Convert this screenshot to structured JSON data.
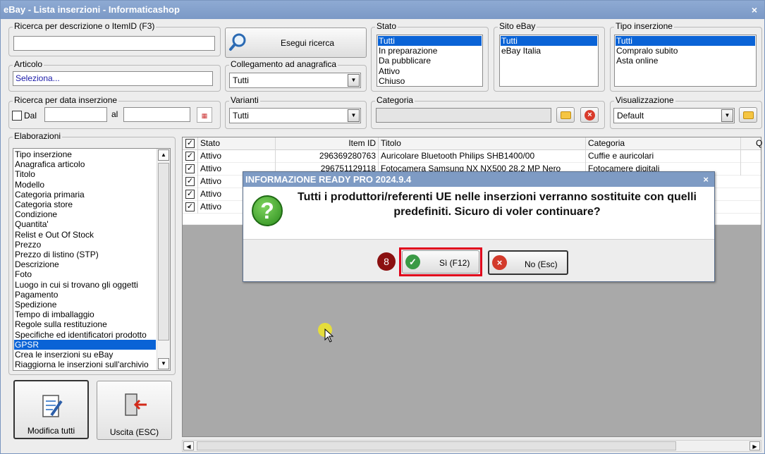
{
  "window": {
    "title": "eBay - Lista inserzioni - Informaticashop",
    "close": "×"
  },
  "search": {
    "desc_label": "Ricerca per descrizione o ItemID (F3)",
    "desc_value": "",
    "execute_label": "Esegui ricerca",
    "article_label": "Articolo",
    "article_value": "Seleziona...",
    "link_label": "Collegamento ad anagrafica",
    "link_value": "Tutti",
    "date_label": "Ricerca per data inserzione",
    "date_from_label": "Dal",
    "date_to_label": "al",
    "variants_label": "Varianti",
    "variants_value": "Tutti",
    "category_label": "Categoria",
    "view_label": "Visualizzazione",
    "view_value": "Default"
  },
  "stato": {
    "label": "Stato",
    "items": [
      "Tutti",
      "In preparazione",
      "Da pubblicare",
      "Attivo",
      "Chiuso"
    ]
  },
  "sito": {
    "label": "Sito eBay",
    "items": [
      "Tutti",
      "eBay Italia"
    ]
  },
  "tipo": {
    "label": "Tipo inserzione",
    "items": [
      "Tutti",
      "Compralo subito",
      "Asta online"
    ]
  },
  "elaborazioni": {
    "label": "Elaborazioni",
    "items": [
      "Tipo inserzione",
      "Anagrafica articolo",
      "Titolo",
      "Modello",
      "Categoria primaria",
      "Categoria store",
      "Condizione",
      "Quantita'",
      "Relist e Out Of Stock",
      "Prezzo",
      "Prezzo di listino (STP)",
      "Descrizione",
      "Foto",
      "Luogo in cui si trovano gli oggetti",
      "Pagamento",
      "Spedizione",
      "Tempo di imballaggio",
      "Regole sulla restituzione",
      "Specifiche ed identificatori prodotto",
      "GPSR",
      "Crea le inserzioni su eBay",
      "Riaggiorna le inserzioni sull'archivio"
    ],
    "selected": "GPSR"
  },
  "actions": {
    "edit_all": "Modifica tutti",
    "exit": "Uscita (ESC)"
  },
  "grid": {
    "headers": {
      "stato": "Stato",
      "itemid": "Item ID",
      "titolo": "Titolo",
      "categoria": "Categoria",
      "q": "Q"
    },
    "rows": [
      {
        "stato": "Attivo",
        "itemid": "296369280763",
        "titolo": "Auricolare Bluetooth Philips SHB1400/00",
        "categoria": "Cuffie e auricolari"
      },
      {
        "stato": "Attivo",
        "itemid": "296751129118",
        "titolo": "Fotocamera Samsung NX NX500 28.2 MP Nero",
        "categoria": "Fotocamere digitali"
      },
      {
        "stato": "Attivo",
        "itemid": "",
        "titolo": "",
        "categoria": ""
      },
      {
        "stato": "Attivo",
        "itemid": "",
        "titolo": "",
        "categoria": ""
      },
      {
        "stato": "Attivo",
        "itemid": "",
        "titolo": "",
        "categoria": ""
      }
    ]
  },
  "dialog": {
    "title": "INFORMAZIONE READY PRO 2024.9.4",
    "message": "Tutti i produttori/referenti UE nelle inserzioni verranno sostituite con quelli predefiniti. Sicuro di voler continuare?",
    "yes_label": "Sì (F12)",
    "no_label": "No (Esc)",
    "step_badge": "8",
    "close": "×"
  },
  "colors": {
    "selection": "#0a63d6",
    "highlight": "#e0001b",
    "badge": "#8b1111"
  }
}
